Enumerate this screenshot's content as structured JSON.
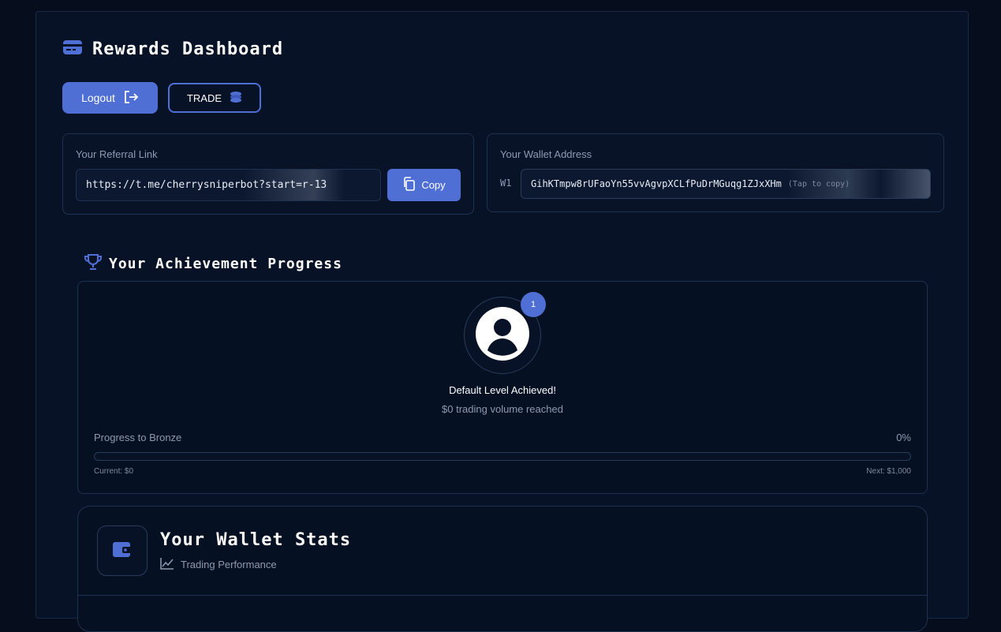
{
  "header": {
    "title": "Rewards Dashboard",
    "icon": "card-icon"
  },
  "actions": {
    "logout_label": "Logout",
    "trade_label": "TRADE"
  },
  "referral": {
    "label": "Your Referral Link",
    "link": "https://t.me/cherrysniperbot?start=r-13",
    "copy_label": "Copy"
  },
  "wallet": {
    "label": "Your Wallet Address",
    "prefix": "W1",
    "address": "GihKTmpw8rUFaoYn55vvAgvpXCLfPuDrMGuqg1ZJxXHm",
    "tap_hint": "(Tap to copy)"
  },
  "achievement": {
    "title": "Your Achievement Progress",
    "badge_count": "1",
    "level_text": "Default Level Achieved!",
    "volume_text": "$0 trading volume reached",
    "progress_label": "Progress to Bronze",
    "progress_percent": "0%",
    "progress_value": 0,
    "current_text": "Current: $0",
    "next_text": "Next: $1,000"
  },
  "wallet_stats": {
    "title": "Your Wallet Stats",
    "subtitle": "Trading Performance"
  },
  "colors": {
    "accent": "#4f6fd4",
    "background": "#060d1c",
    "panel": "#071226"
  }
}
